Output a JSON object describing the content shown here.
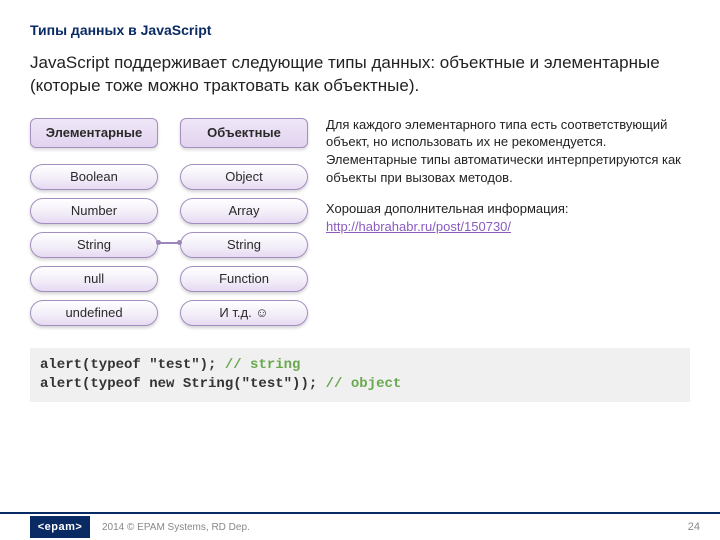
{
  "title": "Типы данных в JavaScript",
  "intro": "JavaScript поддерживает следующие типы данных: объектные и элементарные (которые тоже можно трактовать как объектные).",
  "columns": {
    "primitive": {
      "header": "Элементарные",
      "items": [
        "Boolean",
        "Number",
        "String",
        "null",
        "undefined"
      ]
    },
    "object": {
      "header": "Объектные",
      "items": [
        "Object",
        "Array",
        "String",
        "Function",
        "И т.д. ☺"
      ]
    }
  },
  "side": {
    "para1": "Для каждого элементарного типа есть соответствующий объект, но использовать их не рекомендуется. Элементарные типы автоматически интерпретируются как объекты при вызовах методов.",
    "para2_prefix": "Хорошая дополнительная информация: ",
    "link_text": "http://habrahabr.ru/post/150730/"
  },
  "code": {
    "line1_code": "alert(typeof \"test\"); ",
    "line1_comment": "// string",
    "line2_code": "alert(typeof new String(\"test\")); ",
    "line2_comment": "// object"
  },
  "footer": {
    "logo": "<epam>",
    "copyright": "2014 © EPAM Systems, RD Dep.",
    "page": "24"
  }
}
